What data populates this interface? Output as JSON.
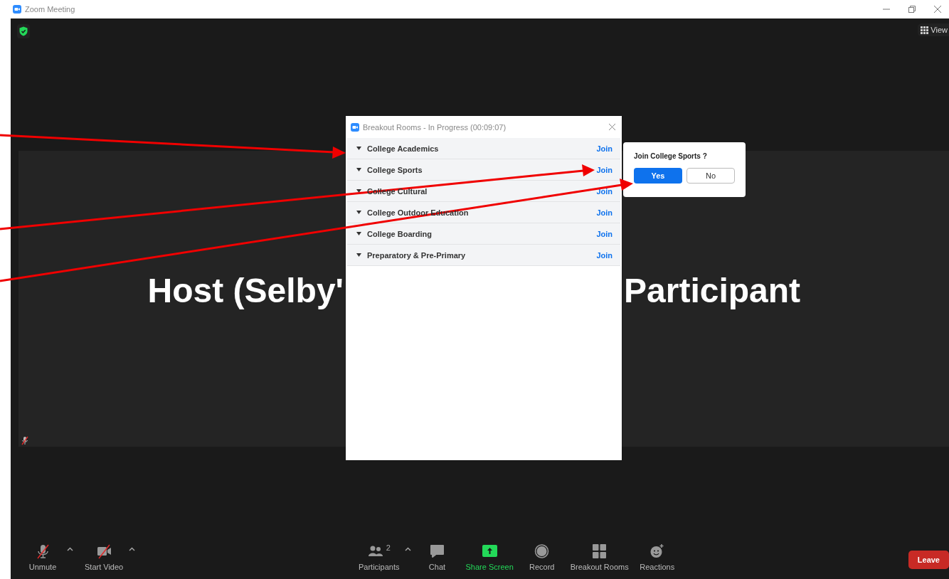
{
  "window": {
    "title": "Zoom Meeting"
  },
  "top_bar": {
    "view_button": "View"
  },
  "video_tile": {
    "name_left": "Host (Selby'",
    "name_right": "Participant",
    "muted": true
  },
  "breakout_dialog": {
    "title": "Breakout Rooms - In Progress (00:09:07)",
    "rooms": [
      {
        "name": "College Academics",
        "join": "Join"
      },
      {
        "name": "College Sports",
        "join": "Join"
      },
      {
        "name": "College Cultural",
        "join": "Join"
      },
      {
        "name": "College Outdoor Education",
        "join": "Join"
      },
      {
        "name": "College Boarding",
        "join": "Join"
      },
      {
        "name": "Preparatory & Pre-Primary",
        "join": "Join"
      }
    ]
  },
  "confirm_popover": {
    "question": "Join College Sports ?",
    "buttons": [
      {
        "label": "Yes",
        "kind": "primary"
      },
      {
        "label": "No",
        "kind": "secondary"
      }
    ]
  },
  "toolbar": {
    "items": [
      {
        "label": "Unmute",
        "kind": "mic",
        "off": true,
        "has_menu": true
      },
      {
        "label": "Start Video",
        "kind": "video",
        "off": true,
        "has_menu": true
      },
      {
        "label": "Participants",
        "kind": "participants",
        "count": "2",
        "off": false,
        "has_menu": true
      },
      {
        "label": "Chat",
        "kind": "chat",
        "off": false,
        "has_menu": false
      },
      {
        "label": "Share Screen",
        "kind": "share",
        "off": false,
        "has_menu": false
      },
      {
        "label": "Record",
        "kind": "record",
        "off": false,
        "has_menu": false
      },
      {
        "label": "Breakout Rooms",
        "kind": "breakout",
        "off": false,
        "has_menu": false
      },
      {
        "label": "Reactions",
        "kind": "reactions",
        "off": false,
        "has_menu": false
      }
    ],
    "leave": "Leave"
  }
}
